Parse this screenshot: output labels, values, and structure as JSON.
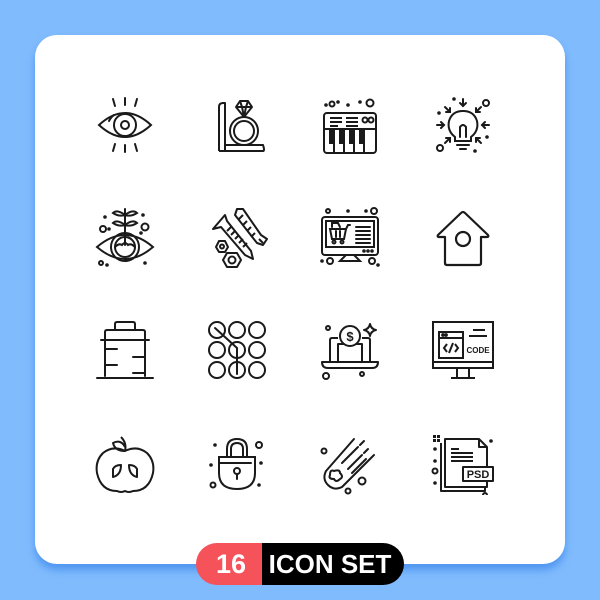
{
  "colors": {
    "background": "#80bbfd",
    "card": "#ffffff",
    "icon_stroke": "#1a1a1a",
    "badge_number_bg": "#f5525a",
    "badge_label_bg": "#000000"
  },
  "icons": [
    {
      "name": "eye-vision-icon"
    },
    {
      "name": "diamond-ring-box-icon"
    },
    {
      "name": "synthesizer-keyboard-icon"
    },
    {
      "name": "lightbulb-idea-icon"
    },
    {
      "name": "eye-plant-growth-icon"
    },
    {
      "name": "screws-bolts-nuts-icon"
    },
    {
      "name": "online-shopping-monitor-icon"
    },
    {
      "name": "birdhouse-icon"
    },
    {
      "name": "battery-jar-icon"
    },
    {
      "name": "pattern-lock-icon"
    },
    {
      "name": "laptop-dollar-icon"
    },
    {
      "name": "code-monitor-icon"
    },
    {
      "name": "apple-fruit-icon"
    },
    {
      "name": "padlock-icon"
    },
    {
      "name": "meteor-comet-icon"
    },
    {
      "name": "psd-file-icon"
    }
  ],
  "code_monitor": {
    "text": "CODE"
  },
  "laptop_dollar": {
    "symbol": "$"
  },
  "psd_file": {
    "text": "PSD"
  },
  "badge": {
    "count": "16",
    "label": "ICON SET"
  }
}
